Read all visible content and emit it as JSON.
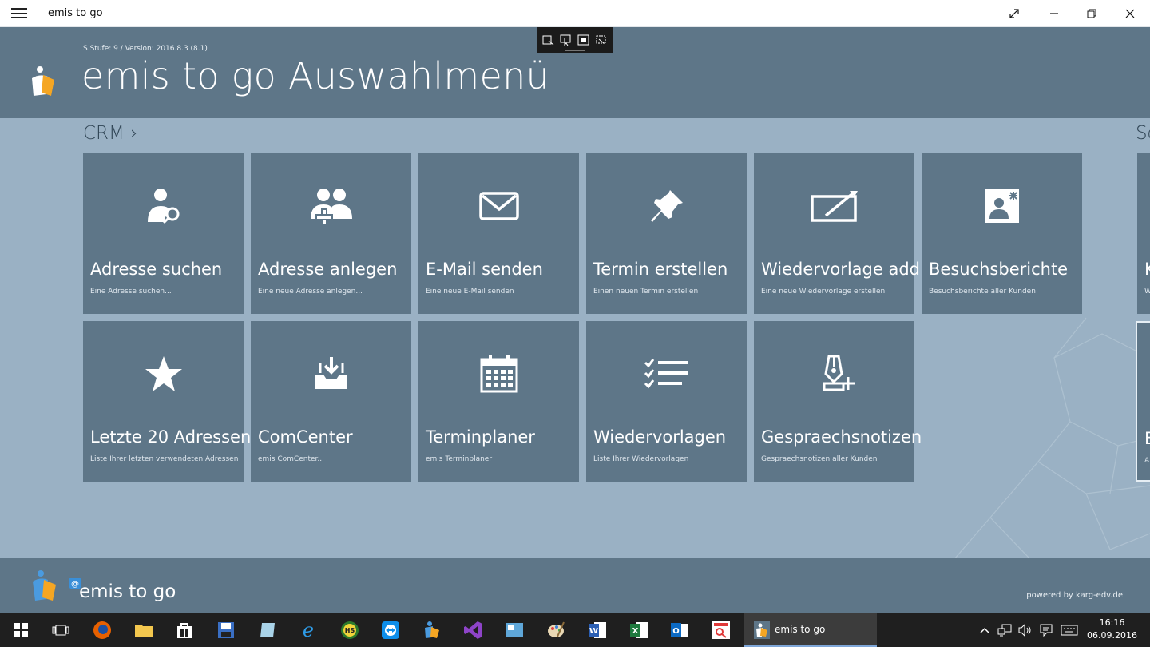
{
  "window": {
    "title": "emis to go"
  },
  "header": {
    "version": "S.Stufe: 9 / Version: 2016.8.3 (8.1)",
    "title": "emis to go Auswahlmenü"
  },
  "sections": [
    {
      "label": "CRM ›"
    },
    {
      "label": "Sc"
    }
  ],
  "tiles": [
    {
      "name": "Adresse suchen",
      "desc": "Eine Adresse suchen...",
      "icon": "person-search-icon"
    },
    {
      "name": "Adresse anlegen",
      "desc": "Eine neue Adresse anlegen...",
      "icon": "person-add-icon"
    },
    {
      "name": "E-Mail senden",
      "desc": "Eine neue E-Mail senden",
      "icon": "mail-icon"
    },
    {
      "name": "Termin erstellen",
      "desc": "Einen neuen Termin erstellen",
      "icon": "pin-icon"
    },
    {
      "name": "Wiedervorlage add",
      "desc": "Eine neue Wiedervorlage erstellen",
      "icon": "edit-icon"
    },
    {
      "name": "Besuchsberichte",
      "desc": "Besuchsberichte aller Kunden",
      "icon": "contact-card-icon"
    },
    {
      "name": "Letzte 20 Adressen",
      "desc": "Liste Ihrer letzten verwendeten Adressen",
      "icon": "star-icon"
    },
    {
      "name": "ComCenter",
      "desc": "emis ComCenter...",
      "icon": "inbox-icon"
    },
    {
      "name": "Terminplaner",
      "desc": "emis Terminplaner",
      "icon": "calendar-icon"
    },
    {
      "name": "Wiedervorlagen",
      "desc": "Liste Ihrer Wiedervorlagen",
      "icon": "checklist-icon"
    },
    {
      "name": "Gespraechsnotizen",
      "desc": "Gespraechsnotizen aller Kunden",
      "icon": "pen-add-icon"
    }
  ],
  "edge_tiles": [
    {
      "letter": "K",
      "sub": "W"
    },
    {
      "letter": "E",
      "sub": "A"
    }
  ],
  "footer": {
    "app_name": "emis to go",
    "powered": "powered by karg-edv.de"
  },
  "taskbar": {
    "active_label": "emis to go",
    "time": "16:16",
    "date": "06.09.2016"
  },
  "colors": {
    "tile": "#5e7688",
    "background": "#9ab1c4",
    "accent_orange": "#f5a623"
  }
}
